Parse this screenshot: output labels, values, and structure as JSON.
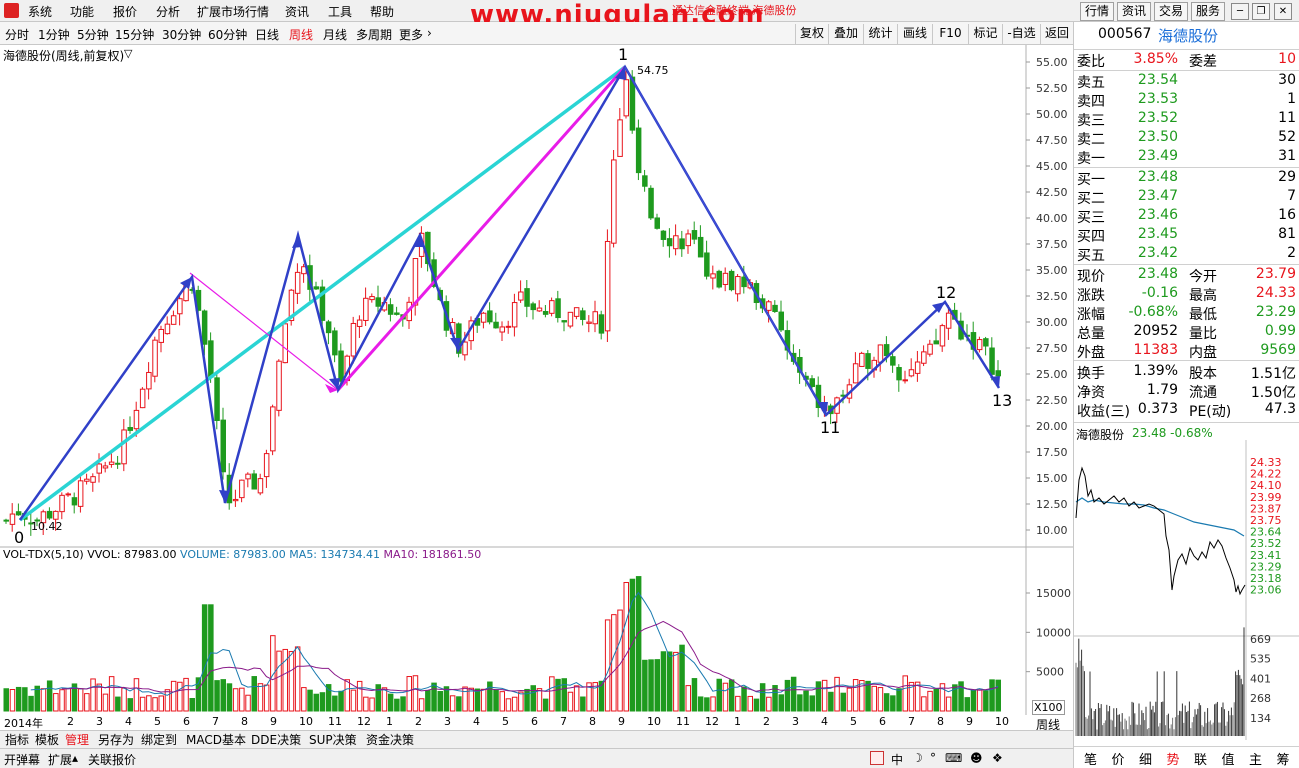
{
  "menubar": {
    "items": [
      "系统",
      "功能",
      "报价",
      "分析",
      "扩展市场行情",
      "资讯",
      "工具",
      "帮助"
    ],
    "watermark": "www.niugulan.com",
    "app_title": "通达信金融终端 海德股份",
    "right_buttons": [
      "行情",
      "资讯",
      "交易",
      "服务"
    ]
  },
  "periodbar": {
    "periods": [
      "分时",
      "1分钟",
      "5分钟",
      "15分钟",
      "30分钟",
      "60分钟",
      "日线",
      "周线",
      "月线",
      "多周期",
      "更多"
    ],
    "active": "周线",
    "tools": [
      "复权",
      "叠加",
      "统计",
      "画线",
      "F10",
      "标记",
      "-自选",
      "返回"
    ]
  },
  "chart": {
    "stock_label": "海德股份(周线,前复权)",
    "wave_labels": [
      "0",
      "1",
      "11",
      "12",
      "13"
    ],
    "low_label": "10.42",
    "high_label": "54.75",
    "price_ticks": [
      "55.00",
      "52.50",
      "50.00",
      "47.50",
      "45.00",
      "42.50",
      "40.00",
      "37.50",
      "35.00",
      "32.50",
      "30.00",
      "27.50",
      "25.00",
      "22.50",
      "20.00",
      "17.50",
      "15.00",
      "12.50",
      "10.00"
    ],
    "vol_header": {
      "name": "VOL-TDX(5,10)",
      "vvol": "VVOL: 87983.00",
      "volume": "VOLUME: 87983.00",
      "ma5": "MA5: 134734.41",
      "ma10": "MA10: 181861.50"
    },
    "vol_ticks": [
      "15000",
      "10000",
      "5000"
    ],
    "vol_unit": "X100",
    "time_axis": [
      "2014年",
      "2",
      "3",
      "4",
      "5",
      "6",
      "7",
      "8",
      "9",
      "10",
      "11",
      "12",
      "1",
      "2",
      "3",
      "4",
      "5",
      "6",
      "7",
      "8",
      "9",
      "10",
      "11",
      "12",
      "1",
      "2",
      "3",
      "4",
      "5",
      "6",
      "7",
      "8",
      "9",
      "10"
    ],
    "period_label": "周线"
  },
  "chart_data": {
    "type": "candlestick",
    "price_range": [
      9,
      57
    ],
    "volume_range": [
      0,
      20000
    ],
    "pivots": [
      {
        "label": "0",
        "price": 10.42
      },
      {
        "label": "1",
        "price": 54.75
      },
      {
        "label": "11",
        "price": 21.0
      },
      {
        "label": "12",
        "price": 31.5
      },
      {
        "label": "13",
        "price": 23.8
      }
    ]
  },
  "bottom_tabs": [
    "指标",
    "模板",
    "管理",
    "另存为",
    "绑定到",
    "MACD基本",
    "DDE决策",
    "SUP决策",
    "资金决策"
  ],
  "status_tabs": [
    "开弹幕",
    "扩展",
    "关联报价"
  ],
  "quote": {
    "code": "000567",
    "name": "海德股份",
    "weibi_label": "委比",
    "weibi": "3.85%",
    "weicha_label": "委差",
    "weicha": "10",
    "asks": [
      {
        "label": "卖五",
        "price": "23.54",
        "vol": "30"
      },
      {
        "label": "卖四",
        "price": "23.53",
        "vol": "1"
      },
      {
        "label": "卖三",
        "price": "23.52",
        "vol": "11"
      },
      {
        "label": "卖二",
        "price": "23.50",
        "vol": "52"
      },
      {
        "label": "卖一",
        "price": "23.49",
        "vol": "31"
      }
    ],
    "bids": [
      {
        "label": "买一",
        "price": "23.48",
        "vol": "29"
      },
      {
        "label": "买二",
        "price": "23.47",
        "vol": "7"
      },
      {
        "label": "买三",
        "price": "23.46",
        "vol": "16"
      },
      {
        "label": "买四",
        "price": "23.45",
        "vol": "81"
      },
      {
        "label": "买五",
        "price": "23.42",
        "vol": "2"
      }
    ],
    "stats": [
      {
        "l": "现价",
        "v": "23.48",
        "l2": "今开",
        "v2": "23.79"
      },
      {
        "l": "涨跌",
        "v": "-0.16",
        "l2": "最高",
        "v2": "24.33"
      },
      {
        "l": "涨幅",
        "v": "-0.68%",
        "l2": "最低",
        "v2": "23.29"
      },
      {
        "l": "总量",
        "v": "20952",
        "l2": "量比",
        "v2": "0.99"
      },
      {
        "l": "外盘",
        "v": "11383",
        "l2": "内盘",
        "v2": "9569"
      }
    ],
    "stats2": [
      {
        "l": "换手",
        "v": "1.39%",
        "l2": "股本",
        "v2": "1.51亿"
      },
      {
        "l": "净资",
        "v": "1.79",
        "l2": "流通",
        "v2": "1.50亿"
      },
      {
        "l": "收益(三)",
        "v": "0.373",
        "l2": "PE(动)",
        "v2": "47.3"
      }
    ],
    "mini_title": "海德股份",
    "mini_change": "23.48 -0.68%",
    "mini_ticks": [
      "24.33",
      "24.22",
      "24.10",
      "23.99",
      "23.87",
      "23.75",
      "23.64",
      "23.52",
      "23.41",
      "23.29",
      "23.18",
      "23.06"
    ],
    "mini_vol_ticks": [
      "669",
      "535",
      "401",
      "268",
      "134"
    ],
    "bottom_tabs": [
      "笔",
      "价",
      "细",
      "势",
      "联",
      "值",
      "主",
      "筹"
    ]
  }
}
